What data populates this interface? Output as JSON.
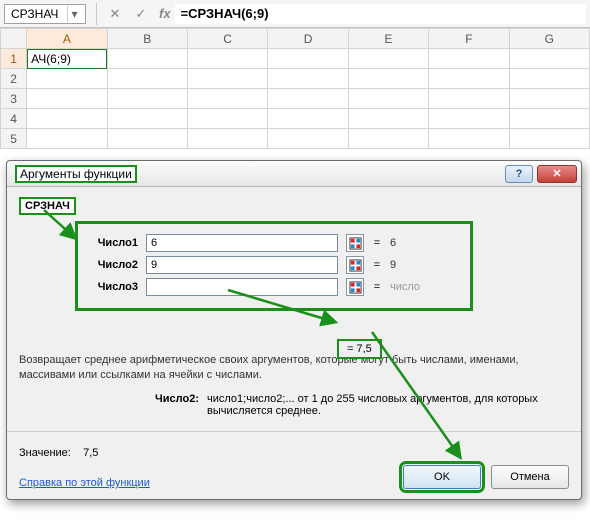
{
  "formulaBar": {
    "nameBox": "СРЗНАЧ",
    "formula": "=СРЗНАЧ(6;9)"
  },
  "grid": {
    "columns": [
      "A",
      "B",
      "C",
      "D",
      "E",
      "F",
      "G"
    ],
    "rows": [
      "1",
      "2",
      "3",
      "4",
      "5"
    ],
    "editingCell": "АЧ(6;9)"
  },
  "dialog": {
    "title": "Аргументы функции",
    "helpGlyph": "?",
    "closeGlyph": "✕",
    "functionName": "СРЗНАЧ",
    "args": [
      {
        "label": "Число1",
        "value": "6",
        "result": "6",
        "faint": false
      },
      {
        "label": "Число2",
        "value": "9",
        "result": "9",
        "faint": false
      },
      {
        "label": "Число3",
        "value": "",
        "result": "число",
        "faint": true
      }
    ],
    "interimResult": "=  7,5",
    "description": "Возвращает среднее арифметическое своих аргументов, которые могут быть числами, именами, массивами или ссылками на ячейки с числами.",
    "argHelp": {
      "label": "Число2:",
      "text": "число1;число2;... от 1 до 255 числовых аргументов, для которых вычисляется среднее."
    },
    "resultLabel": "Значение:",
    "resultValue": "7,5",
    "helpLink": "Справка по этой функции",
    "okLabel": "OK",
    "cancelLabel": "Отмена"
  }
}
